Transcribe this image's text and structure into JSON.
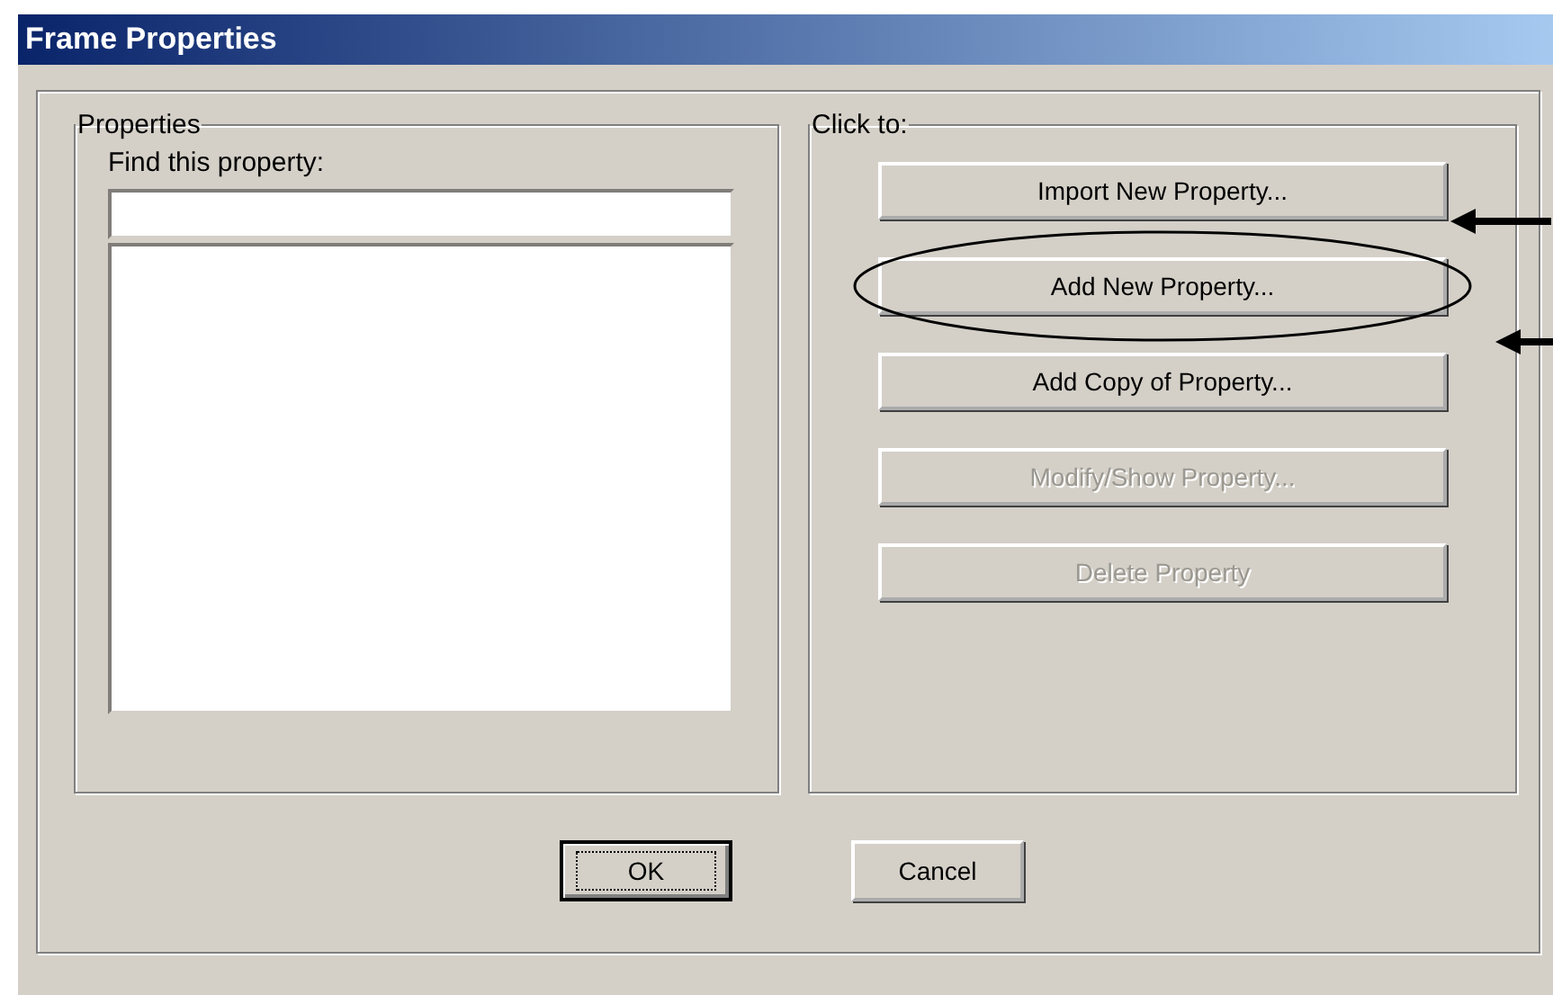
{
  "window": {
    "title": "Frame Properties"
  },
  "properties_group": {
    "label": "Properties",
    "search": {
      "label": "Find this property:"
    }
  },
  "actions_group": {
    "label": "Click to:",
    "buttons": [
      {
        "label": "Import New Property...",
        "disabled": false,
        "circled": false,
        "pointed": true
      },
      {
        "label": "Add New Property...",
        "disabled": false,
        "circled": true,
        "pointed": true
      },
      {
        "label": "Add Copy of Property...",
        "disabled": false,
        "circled": false,
        "pointed": false
      },
      {
        "label": "Modify/Show Property...",
        "disabled": true,
        "circled": false,
        "pointed": false
      },
      {
        "label": "Delete Property",
        "disabled": true,
        "circled": false,
        "pointed": false
      }
    ]
  },
  "footer_buttons": [
    {
      "label": "OK",
      "default": true
    },
    {
      "label": "Cancel",
      "default": false
    }
  ]
}
